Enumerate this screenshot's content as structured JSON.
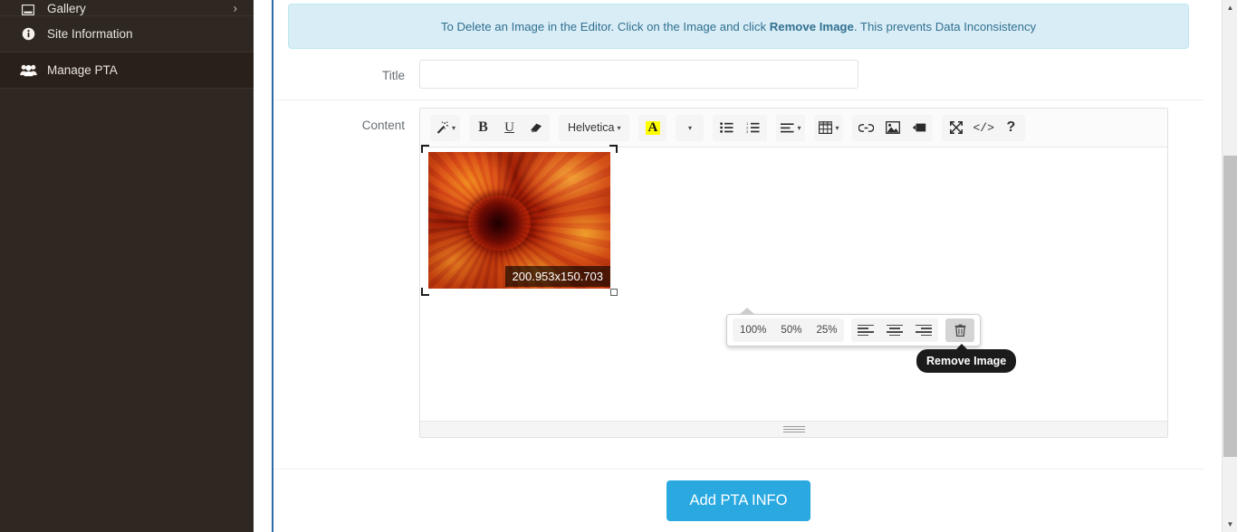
{
  "sidebar": {
    "items": [
      {
        "label": "Gallery",
        "icon": "image-icon",
        "chevron": "›",
        "partial": true,
        "active": false
      },
      {
        "label": "Site Information",
        "icon": "info-icon",
        "chevron": "",
        "partial": false,
        "active": false
      },
      {
        "label": "Manage PTA",
        "icon": "users-icon",
        "chevron": "",
        "partial": false,
        "active": true
      }
    ]
  },
  "alert": {
    "text_before": "To Delete an Image in the Editor. Click on the Image and click ",
    "strong": "Remove Image",
    "text_after": ". This prevents Data Inconsistency",
    "background": "#d9edf7",
    "text_color": "#31708f"
  },
  "form": {
    "title_label": "Title",
    "title_value": "",
    "title_placeholder": "",
    "content_label": "Content"
  },
  "editor": {
    "toolbar": {
      "magic_wand": "✨",
      "bold": "B",
      "underline": "U",
      "clear_format": "◧",
      "font_name": "Helvetica",
      "font_caret": "▾",
      "text_color": "A",
      "color_caret": "▾",
      "unordered_list": "☰",
      "ordered_list": "☰",
      "align": "≡",
      "align_caret": "▾",
      "table": "▦",
      "table_caret": "▾",
      "link": "⚓",
      "image": "ὛC",
      "video": "▶",
      "fullscreen": "⤡",
      "code_view": "</>",
      "help": "?"
    },
    "image": {
      "size_label": "200.953x150.703",
      "alt": "close-up photo of an orange red chrysanthemum flower"
    },
    "image_popup": {
      "sizes": [
        "100%",
        "50%",
        "25%"
      ],
      "aligns": [
        "align-left",
        "align-center",
        "align-right"
      ],
      "remove": "remove-image",
      "active_button": "remove-image"
    },
    "tooltip": "Remove Image"
  },
  "footer": {
    "submit_label": "Add PTA INFO",
    "submit_color": "#29a9e0"
  },
  "scrollbar": {
    "up_arrow": "▲",
    "down_arrow": "▼"
  }
}
